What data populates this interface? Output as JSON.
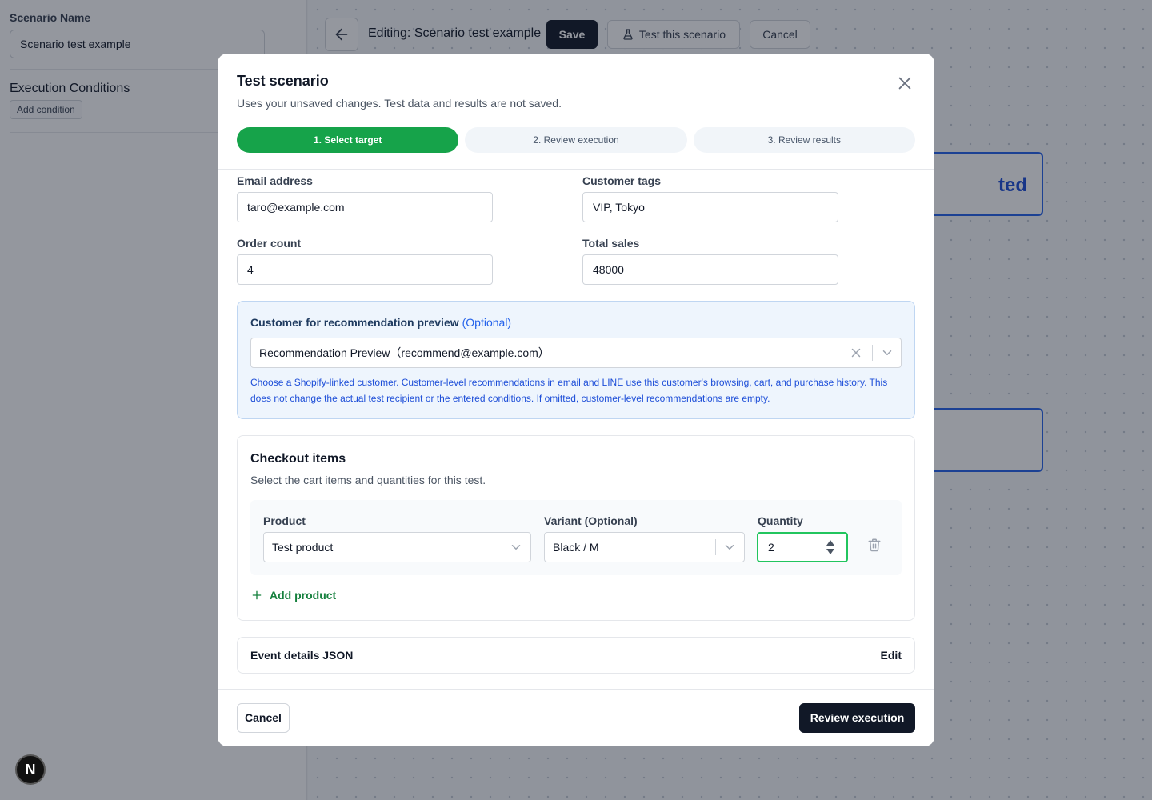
{
  "sidebar": {
    "scenario_name_label": "Scenario Name",
    "scenario_name_value": "Scenario test example",
    "execution_conditions_label": "Execution Conditions",
    "add_condition_label": "Add condition"
  },
  "topbar": {
    "title": "Editing: Scenario test example",
    "save_label": "Save",
    "test_label": "Test this scenario",
    "cancel_label": "Cancel"
  },
  "canvas": {
    "node1_partial_text": "ted"
  },
  "modal": {
    "title": "Test scenario",
    "subtitle": "Uses your unsaved changes. Test data and results are not saved.",
    "steps": [
      {
        "label": "1. Select target",
        "active": true
      },
      {
        "label": "2. Review execution",
        "active": false
      },
      {
        "label": "3. Review results",
        "active": false
      }
    ],
    "fields": {
      "email_label": "Email address",
      "email_value": "taro@example.com",
      "tags_label": "Customer tags",
      "tags_value": "VIP, Tokyo",
      "order_count_label": "Order count",
      "order_count_value": "4",
      "total_sales_label": "Total sales",
      "total_sales_value": "48000"
    },
    "recommendation": {
      "title": "Customer for recommendation preview",
      "optional": "(Optional)",
      "selected": "Recommendation Preview（recommend@example.com）",
      "help": "Choose a Shopify-linked customer. Customer-level recommendations in email and LINE use this customer's browsing, cart, and purchase history. This does not change the actual test recipient or the entered conditions. If omitted, customer-level recommendations are empty."
    },
    "checkout": {
      "title": "Checkout items",
      "subtitle": "Select the cart items and quantities for this test.",
      "product_label": "Product",
      "product_value": "Test product",
      "variant_label": "Variant (Optional)",
      "variant_value": "Black / M",
      "quantity_label": "Quantity",
      "quantity_value": "2",
      "add_product_label": "Add product"
    },
    "event_json": {
      "title": "Event details JSON",
      "edit_label": "Edit"
    },
    "footer": {
      "cancel_label": "Cancel",
      "primary_label": "Review execution"
    }
  },
  "badge": {
    "letter": "N"
  },
  "colors": {
    "accent_green": "#16a34a",
    "primary_dark": "#111827",
    "info_blue": "#2563eb"
  }
}
